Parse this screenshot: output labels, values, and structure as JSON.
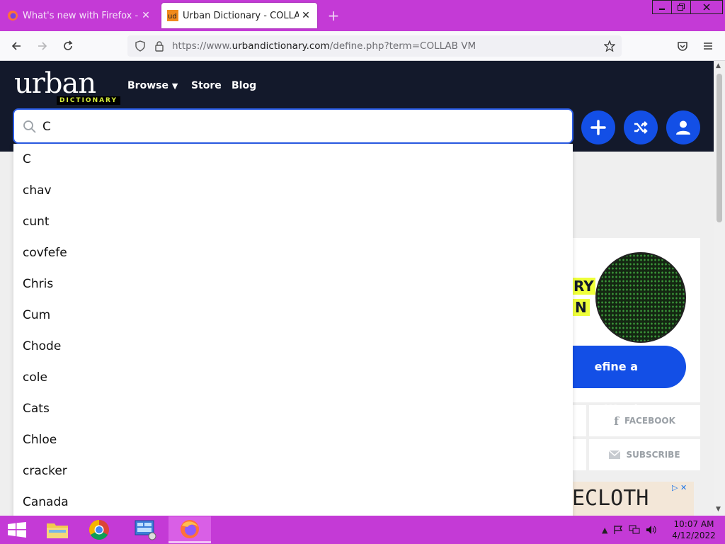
{
  "browser": {
    "tabs": [
      {
        "title": "What's new with Firefox - More",
        "favicon": "firefox-icon",
        "active": false
      },
      {
        "title": "Urban Dictionary - COLLAB VM",
        "favicon": "ud",
        "active": true
      }
    ],
    "url_prefix": "https://www.",
    "url_domain": "urbandictionary.com",
    "url_path": "/define.php?term=COLLAB VM",
    "accent": "#c43ad6"
  },
  "site": {
    "logo_word": "urban",
    "logo_sub": "DICTIONARY",
    "nav": {
      "browse": "Browse",
      "store": "Store",
      "blog": "Blog"
    },
    "search_value": "C",
    "suggestions": [
      "C",
      "chav",
      "cunt",
      "covfefe",
      "Chris",
      "Cum",
      "Chode",
      "cole",
      "Cats",
      "Chloe",
      "cracker",
      "Canada"
    ],
    "promo_line1": "RY",
    "promo_line2": "N",
    "define_label": "efine a Word",
    "facebook_label": "FACEBOOK",
    "subscribe_label": "SUBSCRIBE",
    "ad_text": "ECLOTH",
    "brand_blue": "#134fe6",
    "header_bg": "#13192b"
  },
  "taskbar": {
    "time": "10:07 AM",
    "date": "4/12/2022"
  }
}
